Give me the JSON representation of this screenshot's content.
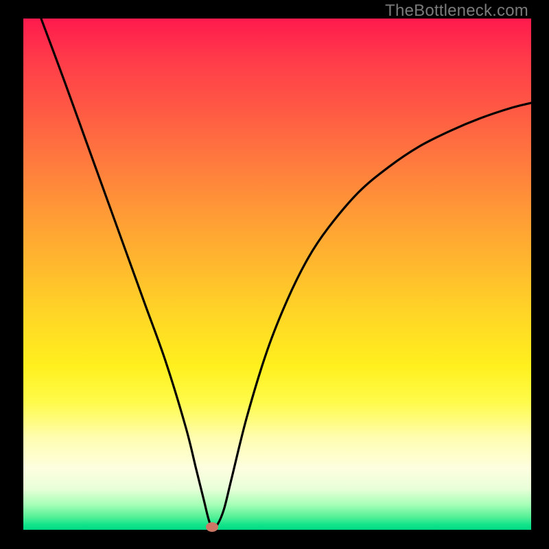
{
  "watermark": "TheBottleneck.com",
  "colors": {
    "background": "#000000",
    "curve": "#000000",
    "marker": "#cc7766"
  },
  "chart_data": {
    "type": "line",
    "title": "",
    "xlabel": "",
    "ylabel": "",
    "xlim": [
      0,
      100
    ],
    "ylim": [
      0,
      100
    ],
    "series": [
      {
        "name": "bottleneck-curve",
        "x": [
          3.5,
          8,
          12,
          16,
          20,
          24,
          28,
          32,
          34,
          35.5,
          36.5,
          37.2,
          38.2,
          39.5,
          41,
          44,
          48,
          52,
          56,
          60,
          66,
          72,
          78,
          84,
          90,
          96,
          100
        ],
        "values": [
          100,
          88,
          77,
          66,
          55,
          44,
          33,
          20,
          12,
          6,
          2,
          0.5,
          1,
          4,
          10,
          22,
          35,
          45,
          53,
          59,
          66,
          71,
          75,
          78,
          80.5,
          82.5,
          83.5
        ]
      }
    ],
    "annotations": [
      {
        "name": "optimal-point-marker",
        "x": 37.2,
        "y": 0.5
      }
    ]
  }
}
